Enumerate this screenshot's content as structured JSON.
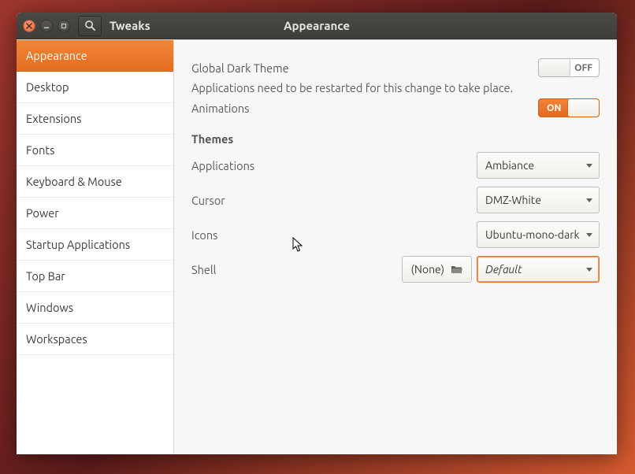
{
  "titlebar": {
    "app_name": "Tweaks",
    "header_title": "Appearance"
  },
  "sidebar": {
    "items": [
      {
        "label": "Appearance",
        "active": true
      },
      {
        "label": "Desktop"
      },
      {
        "label": "Extensions"
      },
      {
        "label": "Fonts"
      },
      {
        "label": "Keyboard & Mouse"
      },
      {
        "label": "Power"
      },
      {
        "label": "Startup Applications"
      },
      {
        "label": "Top Bar"
      },
      {
        "label": "Windows"
      },
      {
        "label": "Workspaces"
      }
    ]
  },
  "appearance": {
    "global_dark_theme": {
      "label": "Global Dark Theme",
      "hint": "Applications need to be restarted for this change to take place.",
      "off_text": "OFF"
    },
    "animations": {
      "label": "Animations",
      "on_text": "ON"
    },
    "themes_header": "Themes",
    "applications": {
      "label": "Applications",
      "value": "Ambiance"
    },
    "cursor": {
      "label": "Cursor",
      "value": "DMZ-White"
    },
    "icons": {
      "label": "Icons",
      "value": "Ubuntu-mono-dark"
    },
    "shell": {
      "label": "Shell",
      "file_label": "(None)",
      "value": "Default"
    }
  }
}
